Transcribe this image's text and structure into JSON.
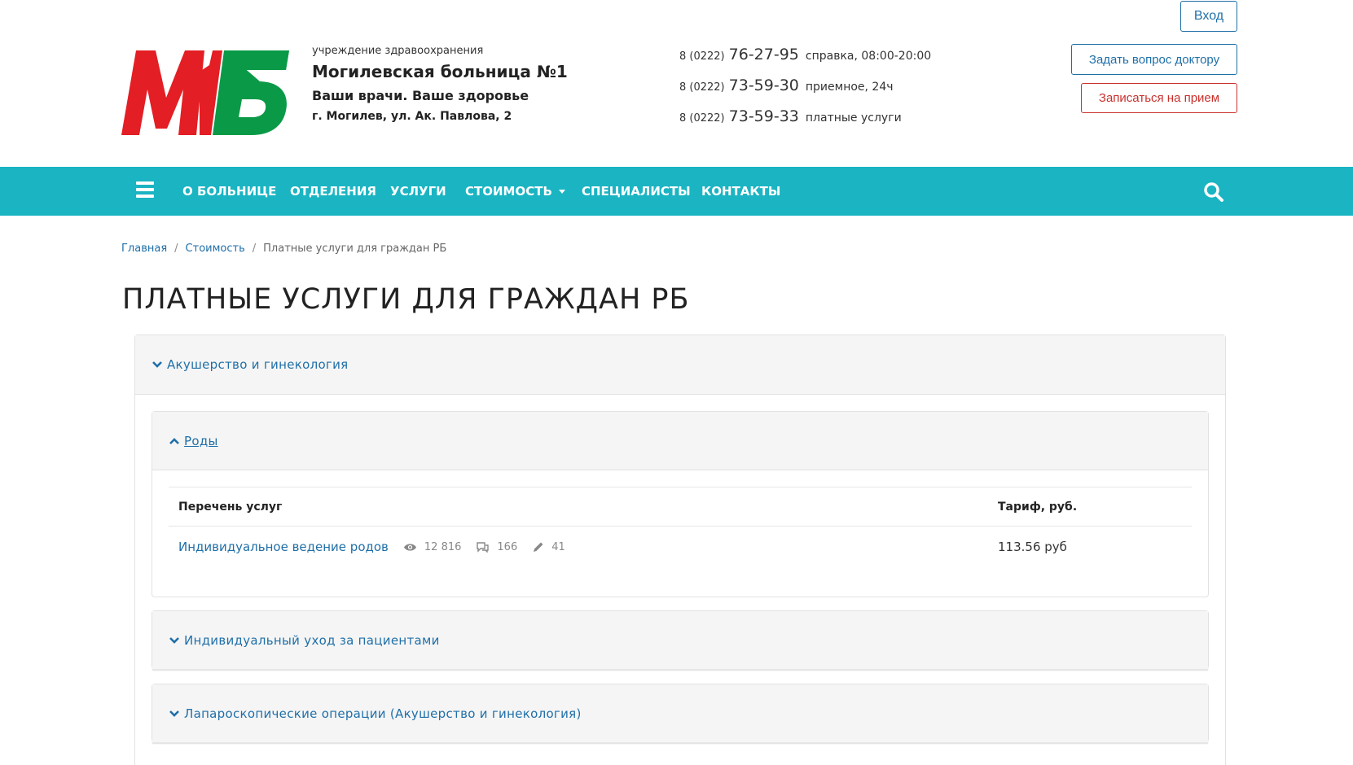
{
  "header": {
    "logo_text": "МБ",
    "org_sub": "учреждение здравоохранения",
    "org_name": "Могилевская больница №1",
    "slogan": "Ваши врачи. Ваше здоровье",
    "address": "г. Могилев, ул. Ак. Павлова, 2",
    "phones": [
      {
        "code": "8 (0222)",
        "number": "76-27-95",
        "note": "справка, 08:00-20:00"
      },
      {
        "code": "8 (0222)",
        "number": "73-59-30",
        "note": "приемное, 24ч"
      },
      {
        "code": "8 (0222)",
        "number": "73-59-33",
        "note": "платные услуги"
      }
    ],
    "login_label": "Вход",
    "ask_label": "Задать вопрос доктору",
    "book_label": "Записаться на прием"
  },
  "nav": {
    "items": [
      "О БОЛЬНИЦЕ",
      "ОТДЕЛЕНИЯ",
      "УСЛУГИ",
      "СТОИМОСТЬ",
      "СПЕЦИАЛИСТЫ",
      "КОНТАКТЫ"
    ],
    "menu_icon": "hamburger-icon",
    "search_icon": "search-icon"
  },
  "breadcrumb": {
    "items": [
      "Главная",
      "Стоимость",
      "Платные услуги для граждан РБ"
    ],
    "separator": "/"
  },
  "page_title": "ПЛАТНЫЕ УСЛУГИ ДЛЯ ГРАЖДАН РБ",
  "accordion": {
    "section_title": "Акушерство и гинекология",
    "panels": [
      {
        "title": "Роды",
        "expanded": true,
        "table": {
          "headers": [
            "Перечень услуг",
            "Тариф, руб."
          ],
          "rows": [
            {
              "service": "Индивидуальное ведение родов",
              "views": "12 816",
              "comments": "166",
              "edits": "41",
              "price": "113.56 руб"
            }
          ]
        }
      },
      {
        "title": "Индивидуальный уход за пациентами",
        "expanded": false
      },
      {
        "title": "Лапароскопические операции (Акушерство и гинекология)",
        "expanded": false
      }
    ]
  },
  "colors": {
    "nav_bg": "#1ab4c2",
    "link": "#1f6fa8",
    "logo_red": "#e31e24",
    "logo_green": "#0a9a47",
    "book_button": "#c9302c"
  }
}
